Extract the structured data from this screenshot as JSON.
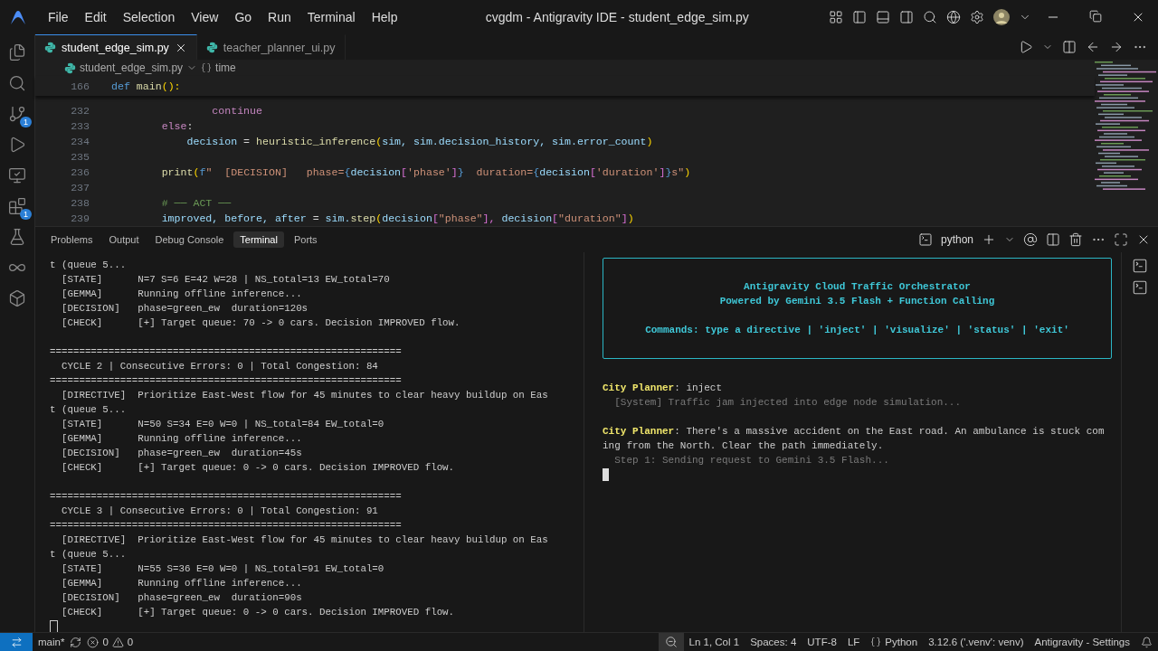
{
  "window": {
    "title": "cvgdm - Antigravity IDE - student_edge_sim.py"
  },
  "menu": [
    "File",
    "Edit",
    "Selection",
    "View",
    "Go",
    "Run",
    "Terminal",
    "Help"
  ],
  "activity_bar": [
    {
      "kind": "explorer"
    },
    {
      "kind": "search"
    },
    {
      "kind": "source-control",
      "badge": "1"
    },
    {
      "kind": "run"
    },
    {
      "kind": "remote"
    },
    {
      "kind": "extensions",
      "badge": "1"
    },
    {
      "kind": "testing"
    },
    {
      "kind": "infinity"
    },
    {
      "kind": "package"
    }
  ],
  "editor_tabs": [
    {
      "label": "student_edge_sim.py",
      "selected": true
    },
    {
      "label": "teacher_planner_ui.py",
      "selected": false
    }
  ],
  "breadcrumb": {
    "file": "student_edge_sim.py",
    "symbol": "time"
  },
  "sticky_line": {
    "number": "166",
    "tokens": [
      {
        "text": "def ",
        "kind": "def"
      },
      {
        "text": "main",
        "kind": "fn"
      },
      {
        "text": "():",
        "kind": "paren"
      }
    ]
  },
  "code_lines": [
    {
      "number": "232",
      "tokens": [
        {
          "text": "                continue",
          "kind": "keyword"
        }
      ]
    },
    {
      "number": "233",
      "tokens": [
        {
          "text": "        else",
          "kind": "keyword"
        },
        {
          "text": ":",
          "kind": "plain"
        }
      ]
    },
    {
      "number": "234",
      "tokens": [
        {
          "text": "            decision",
          "kind": "var"
        },
        {
          "text": " = ",
          "kind": "plain"
        },
        {
          "text": "heuristic_inference",
          "kind": "fn"
        },
        {
          "text": "(",
          "kind": "paren"
        },
        {
          "text": "sim, sim.decision_history, sim.error_count",
          "kind": "var"
        },
        {
          "text": ")",
          "kind": "paren"
        }
      ]
    },
    {
      "number": "235"
    },
    {
      "number": "236",
      "tokens": [
        {
          "text": "        print",
          "kind": "fn"
        },
        {
          "text": "(",
          "kind": "paren"
        },
        {
          "text": "f",
          "kind": "def"
        },
        {
          "text": "\"  [DECISION]   phase=",
          "kind": "string"
        },
        {
          "text": "{",
          "kind": "def"
        },
        {
          "text": "decision",
          "kind": "var"
        },
        {
          "text": "[",
          "kind": "paren2"
        },
        {
          "text": "'phase'",
          "kind": "string"
        },
        {
          "text": "]",
          "kind": "paren2"
        },
        {
          "text": "}",
          "kind": "def"
        },
        {
          "text": "  duration=",
          "kind": "string"
        },
        {
          "text": "{",
          "kind": "def"
        },
        {
          "text": "decision",
          "kind": "var"
        },
        {
          "text": "[",
          "kind": "paren2"
        },
        {
          "text": "'duration'",
          "kind": "string"
        },
        {
          "text": "]",
          "kind": "paren2"
        },
        {
          "text": "}",
          "kind": "def"
        },
        {
          "text": "s\"",
          "kind": "string"
        },
        {
          "text": ")",
          "kind": "paren"
        }
      ]
    },
    {
      "number": "237"
    },
    {
      "number": "238",
      "tokens": [
        {
          "text": "        # ── ACT ──",
          "kind": "comment"
        }
      ]
    },
    {
      "number": "239",
      "tokens": [
        {
          "text": "        improved, before, after",
          "kind": "var"
        },
        {
          "text": " = ",
          "kind": "plain"
        },
        {
          "text": "sim.",
          "kind": "var"
        },
        {
          "text": "step",
          "kind": "fn"
        },
        {
          "text": "(",
          "kind": "paren"
        },
        {
          "text": "decision",
          "kind": "var"
        },
        {
          "text": "[",
          "kind": "paren2"
        },
        {
          "text": "\"phase\"",
          "kind": "string"
        },
        {
          "text": "], ",
          "kind": "paren2"
        },
        {
          "text": "decision",
          "kind": "var"
        },
        {
          "text": "[",
          "kind": "paren2"
        },
        {
          "text": "\"duration\"",
          "kind": "string"
        },
        {
          "text": "]",
          "kind": "paren2"
        },
        {
          "text": ")",
          "kind": "paren"
        }
      ]
    }
  ],
  "panel_tabs": [
    {
      "label": "Problems",
      "selected": false
    },
    {
      "label": "Output",
      "selected": false
    },
    {
      "label": "Debug Console",
      "selected": false
    },
    {
      "label": "Terminal",
      "selected": true
    },
    {
      "label": "Ports",
      "selected": false
    }
  ],
  "terminal_name": "python",
  "terminal_left": [
    {
      "kind": "text",
      "text": "t (queue 5..."
    },
    {
      "kind": "text",
      "text": "  [STATE]      N=7 S=6 E=42 W=28 | NS_total=13 EW_total=70"
    },
    {
      "kind": "text",
      "text": "  [GEMMA]      Running offline inference..."
    },
    {
      "kind": "text",
      "text": "  [DECISION]   phase=green_ew  duration=120s"
    },
    {
      "kind": "text",
      "text": "  [CHECK]      [+] Target queue: 70 -> 0 cars. Decision IMPROVED flow."
    },
    {
      "kind": "blank"
    },
    {
      "kind": "text",
      "text": "============================================================"
    },
    {
      "kind": "text",
      "text": "  CYCLE 2 | Consecutive Errors: 0 | Total Congestion: 84"
    },
    {
      "kind": "text",
      "text": "============================================================"
    },
    {
      "kind": "text",
      "text": "  [DIRECTIVE]  Prioritize East-West flow for 45 minutes to clear heavy buildup on Eas"
    },
    {
      "kind": "text",
      "text": "t (queue 5..."
    },
    {
      "kind": "text",
      "text": "  [STATE]      N=50 S=34 E=0 W=0 | NS_total=84 EW_total=0"
    },
    {
      "kind": "text",
      "text": "  [GEMMA]      Running offline inference..."
    },
    {
      "kind": "text",
      "text": "  [DECISION]   phase=green_ew  duration=45s"
    },
    {
      "kind": "text",
      "text": "  [CHECK]      [+] Target queue: 0 -> 0 cars. Decision IMPROVED flow."
    },
    {
      "kind": "blank"
    },
    {
      "kind": "text",
      "text": "============================================================"
    },
    {
      "kind": "text",
      "text": "  CYCLE 3 | Consecutive Errors: 0 | Total Congestion: 91"
    },
    {
      "kind": "text",
      "text": "============================================================"
    },
    {
      "kind": "text",
      "text": "  [DIRECTIVE]  Prioritize East-West flow for 45 minutes to clear heavy buildup on Eas"
    },
    {
      "kind": "text",
      "text": "t (queue 5..."
    },
    {
      "kind": "text",
      "text": "  [STATE]      N=55 S=36 E=0 W=0 | NS_total=91 EW_total=0"
    },
    {
      "kind": "text",
      "text": "  [GEMMA]      Running offline inference..."
    },
    {
      "kind": "text",
      "text": "  [DECISION]   phase=green_ew  duration=90s"
    },
    {
      "kind": "text",
      "text": "  [CHECK]      [+] Target queue: 0 -> 0 cars. Decision IMPROVED flow."
    },
    {
      "kind": "cursor"
    }
  ],
  "banner": {
    "title": "Antigravity Cloud Traffic Orchestrator",
    "subtitle": "Powered by Gemini 3.5 Flash + Function Calling",
    "commands": "Commands: type a directive | 'inject' | 'visualize' | 'status' | 'exit'"
  },
  "terminal_right": [
    {
      "kind": "prompt",
      "speaker": "City Planner",
      "text": ": inject"
    },
    {
      "kind": "system",
      "text": "  [System] Traffic jam injected into edge node simulation..."
    },
    {
      "kind": "blank"
    },
    {
      "kind": "prompt",
      "speaker": "City Planner",
      "text": ": There's a massive accident on the East road. An ambulance is stuck com"
    },
    {
      "kind": "text",
      "text": "ing from the North. Clear the path immediately."
    },
    {
      "kind": "system",
      "text": "  Step 1: Sending request to Gemini 3.5 Flash..."
    },
    {
      "kind": "cursor"
    }
  ],
  "status_bar": {
    "branch": "main*",
    "errors": "0",
    "warnings": "0",
    "items": [
      "Ln 1, Col 1",
      "Spaces: 4",
      "UTF-8",
      "LF"
    ],
    "language": "Python",
    "interpreter": "3.12.6 ('.venv': venv)",
    "settings": "Antigravity - Settings"
  }
}
